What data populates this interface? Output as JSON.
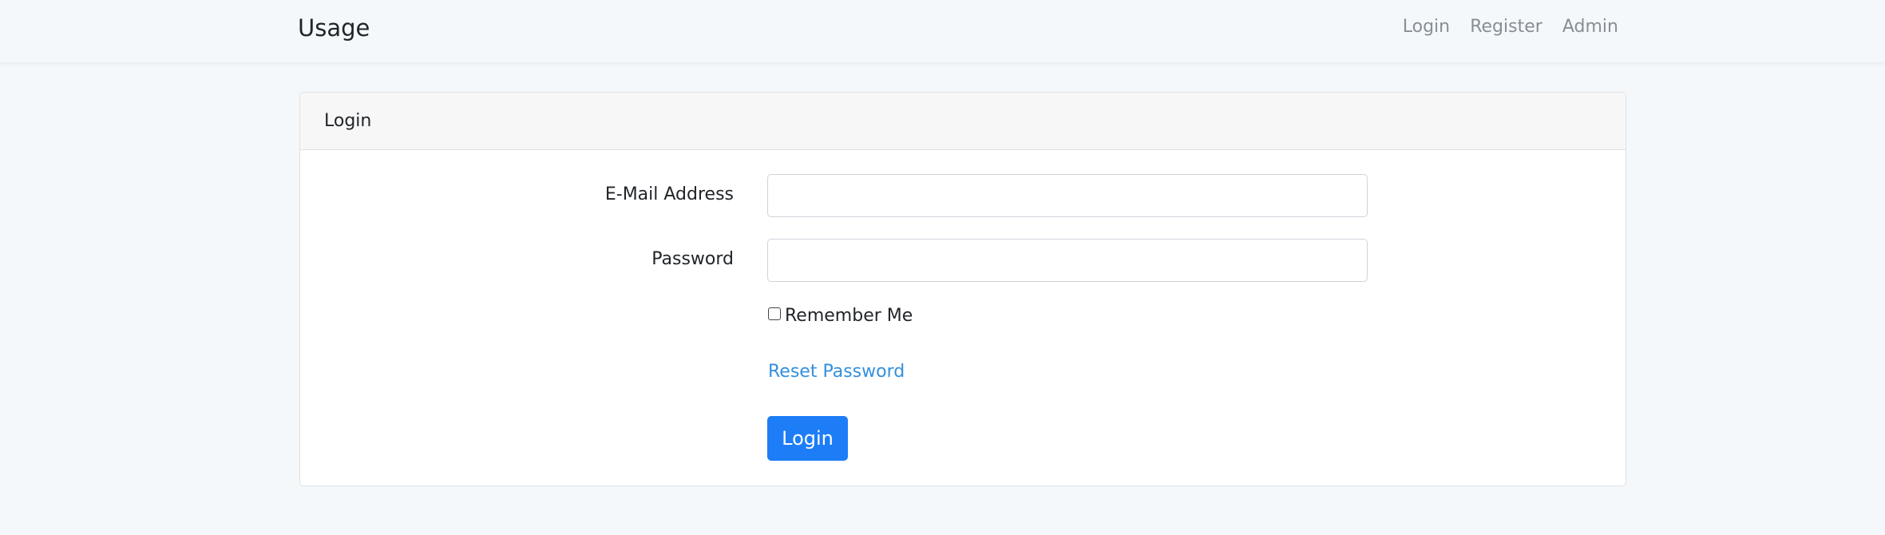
{
  "navbar": {
    "brand": "Usage",
    "links": [
      {
        "label": "Login"
      },
      {
        "label": "Register"
      },
      {
        "label": "Admin"
      }
    ]
  },
  "card": {
    "title": "Login",
    "email": {
      "label": "E-Mail Address",
      "value": "",
      "placeholder": ""
    },
    "password": {
      "label": "Password",
      "value": "",
      "placeholder": ""
    },
    "remember": {
      "label": "Remember Me",
      "checked": false
    },
    "reset_link": "Reset Password",
    "submit_label": "Login"
  },
  "colors": {
    "page_background": "#f5f8fa",
    "primary": "#1d7df7",
    "link": "#3490dc",
    "nav_link": "#868e96"
  }
}
